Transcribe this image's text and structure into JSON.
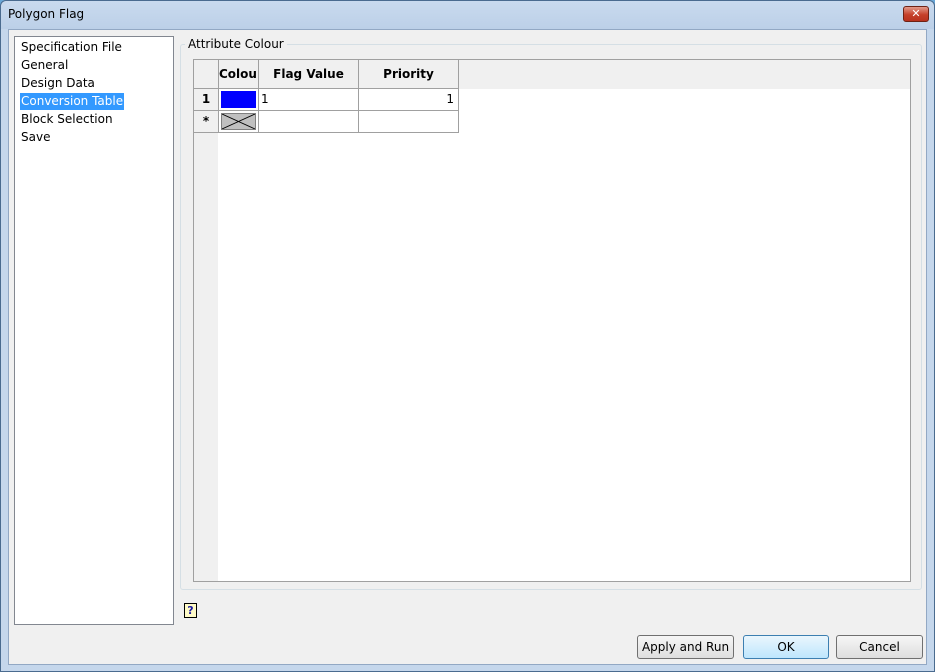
{
  "window": {
    "title": "Polygon Flag",
    "close_glyph": "✕"
  },
  "sidebar": {
    "items": [
      {
        "label": "Specification File",
        "selected": false
      },
      {
        "label": "General",
        "selected": false
      },
      {
        "label": "Design Data",
        "selected": false
      },
      {
        "label": "Conversion Table",
        "selected": true
      },
      {
        "label": "Block Selection",
        "selected": false
      },
      {
        "label": "Save",
        "selected": false
      }
    ]
  },
  "main": {
    "group_label": "Attribute Colour",
    "table": {
      "columns": [
        "Colour",
        "Flag Value",
        "Priority"
      ],
      "rows": [
        {
          "row_header": "1",
          "colour": "#0000ff",
          "flag_value": "1",
          "priority": "1"
        },
        {
          "row_header": "*",
          "colour": "none",
          "flag_value": "",
          "priority": ""
        }
      ]
    }
  },
  "help": {
    "glyph": "?"
  },
  "buttons": {
    "apply_and_run": "Apply and Run",
    "ok": "OK",
    "cancel": "Cancel"
  }
}
